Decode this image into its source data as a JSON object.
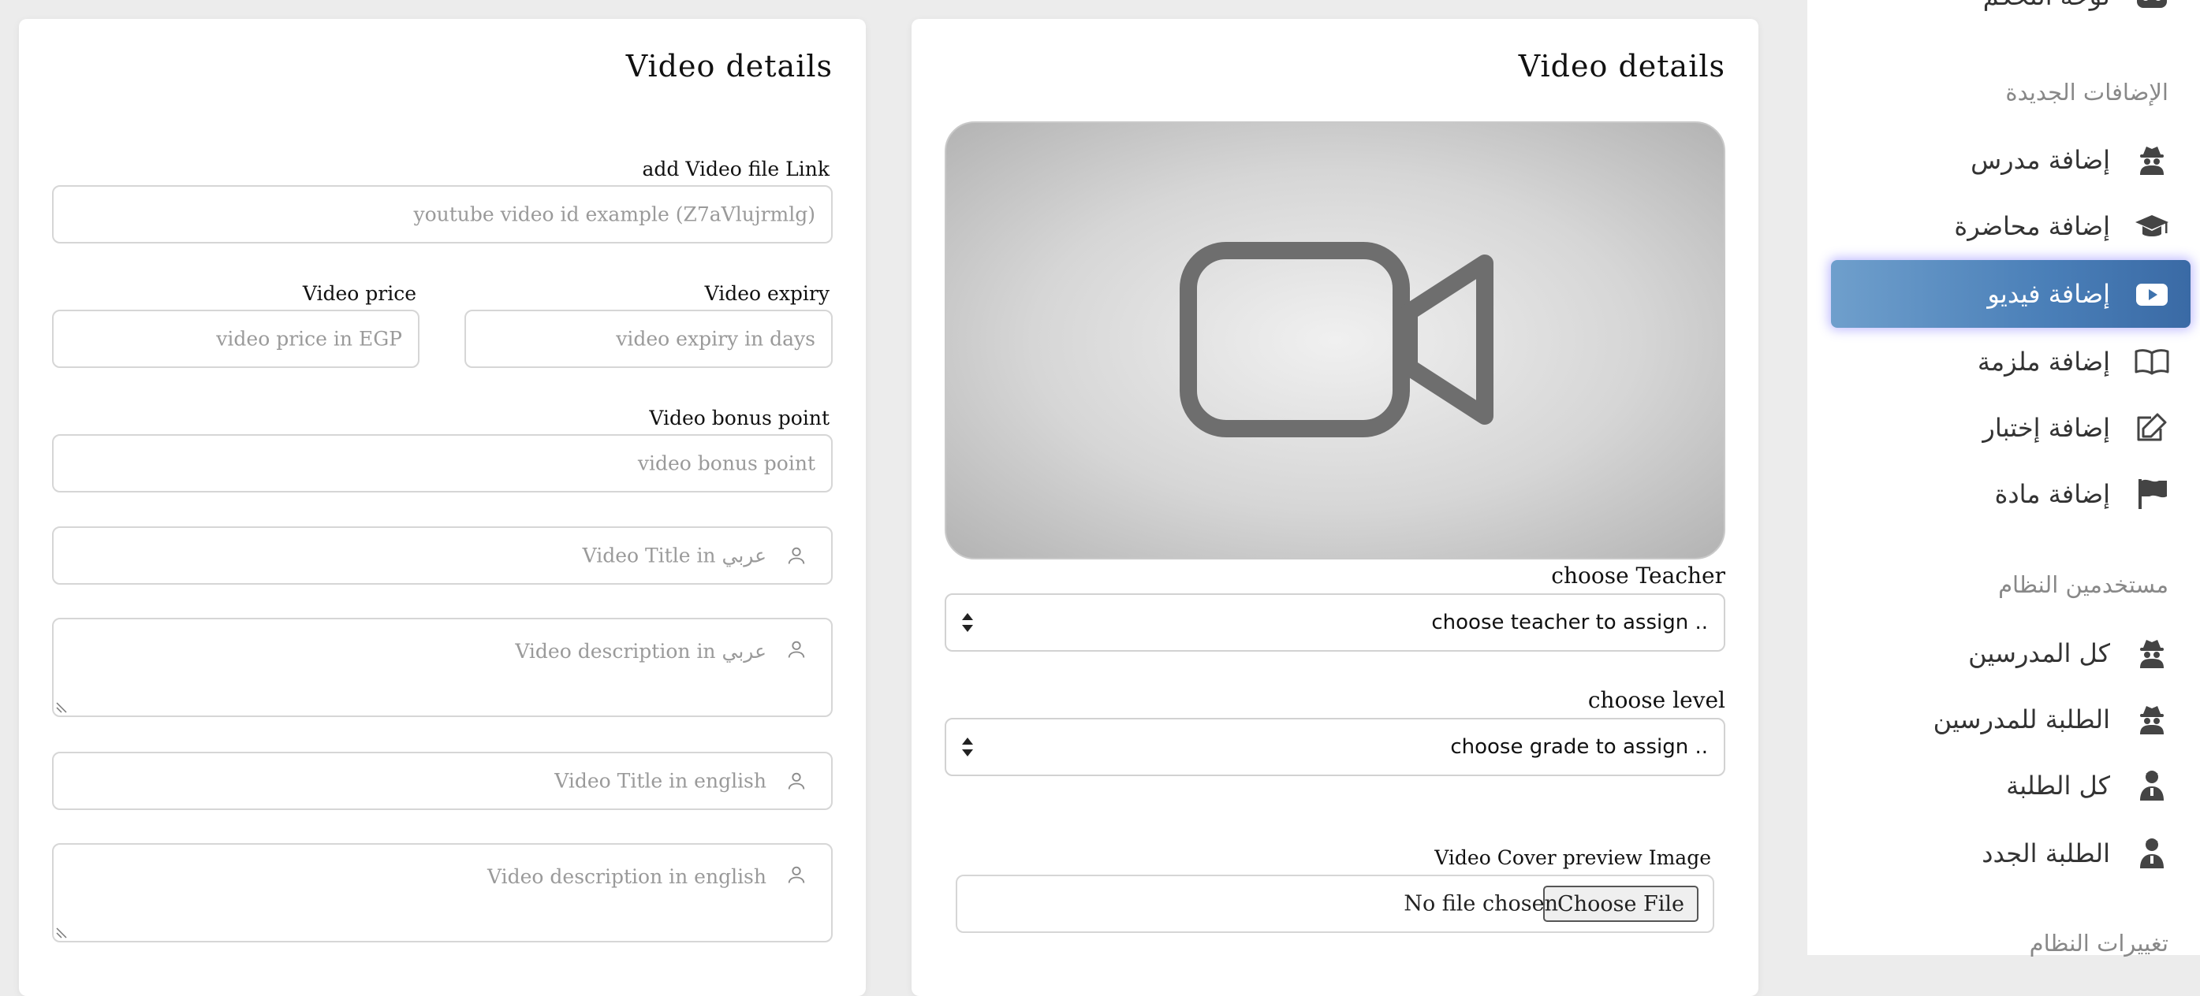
{
  "left_card": {
    "title": "Video details",
    "link_label": "add Video file Link",
    "link_placeholder": "youtube video id example (Z7aVlujrmlg)",
    "expiry_label": "Video expiry",
    "expiry_placeholder": "video expiry in days",
    "price_label": "Video price",
    "price_placeholder": "video price in EGP",
    "bonus_label": "Video bonus point",
    "bonus_placeholder": "video bonus point",
    "title_ar_placeholder": "Video Title in عربي",
    "desc_ar_placeholder": "Video description in عربي",
    "title_en_placeholder": "Video Title in english",
    "desc_en_placeholder": "Video description in english"
  },
  "mid_card": {
    "title": "Video details",
    "preview_icon": "video-camera-icon",
    "teacher_label": "choose Teacher",
    "teacher_value": "choose teacher to assign ..",
    "level_label": "choose level",
    "level_value": "choose grade to assign ..",
    "cover_label": "Video Cover preview Image",
    "choose_file_button": "Choose File",
    "no_file_text": "No file chosen"
  },
  "sidebar": {
    "top_item": "لوحة التحكم",
    "section_new": "الإضافات الجديدة",
    "items_new": [
      {
        "label": "إضافة مدرس",
        "icon": "spy-icon"
      },
      {
        "label": "إضافة محاضرة",
        "icon": "graduation-cap-icon"
      },
      {
        "label": "إضافة فيديو",
        "icon": "youtube-icon",
        "active": true
      },
      {
        "label": "إضافة ملزمة",
        "icon": "book-open-icon"
      },
      {
        "label": "إضافة إختبار",
        "icon": "edit-icon"
      },
      {
        "label": "إضافة مادة",
        "icon": "flag-icon"
      }
    ],
    "section_users": "مستخدمين النظام",
    "items_users": [
      {
        "label": "كل المدرسين",
        "icon": "spy-icon"
      },
      {
        "label": "الطلبة للمدرسين",
        "icon": "spy-icon"
      },
      {
        "label": "كل الطلبة",
        "icon": "student-icon"
      },
      {
        "label": "الطلبة الجدد",
        "icon": "student-icon"
      }
    ],
    "section_changes": "تغييرات النظام"
  },
  "colors": {
    "active_gradient_start": "#6f9fcc",
    "active_gradient_end": "#3a6aa5",
    "icon_color": "#444444"
  }
}
